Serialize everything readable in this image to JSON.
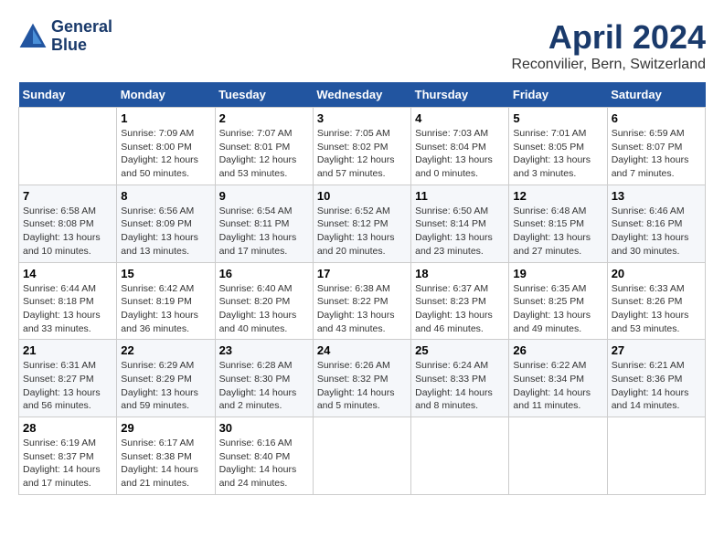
{
  "header": {
    "logo_line1": "General",
    "logo_line2": "Blue",
    "month_title": "April 2024",
    "subtitle": "Reconvilier, Bern, Switzerland"
  },
  "weekdays": [
    "Sunday",
    "Monday",
    "Tuesday",
    "Wednesday",
    "Thursday",
    "Friday",
    "Saturday"
  ],
  "weeks": [
    [
      {
        "day": "",
        "sunrise": "",
        "sunset": "",
        "daylight": ""
      },
      {
        "day": "1",
        "sunrise": "Sunrise: 7:09 AM",
        "sunset": "Sunset: 8:00 PM",
        "daylight": "Daylight: 12 hours and 50 minutes."
      },
      {
        "day": "2",
        "sunrise": "Sunrise: 7:07 AM",
        "sunset": "Sunset: 8:01 PM",
        "daylight": "Daylight: 12 hours and 53 minutes."
      },
      {
        "day": "3",
        "sunrise": "Sunrise: 7:05 AM",
        "sunset": "Sunset: 8:02 PM",
        "daylight": "Daylight: 12 hours and 57 minutes."
      },
      {
        "day": "4",
        "sunrise": "Sunrise: 7:03 AM",
        "sunset": "Sunset: 8:04 PM",
        "daylight": "Daylight: 13 hours and 0 minutes."
      },
      {
        "day": "5",
        "sunrise": "Sunrise: 7:01 AM",
        "sunset": "Sunset: 8:05 PM",
        "daylight": "Daylight: 13 hours and 3 minutes."
      },
      {
        "day": "6",
        "sunrise": "Sunrise: 6:59 AM",
        "sunset": "Sunset: 8:07 PM",
        "daylight": "Daylight: 13 hours and 7 minutes."
      }
    ],
    [
      {
        "day": "7",
        "sunrise": "Sunrise: 6:58 AM",
        "sunset": "Sunset: 8:08 PM",
        "daylight": "Daylight: 13 hours and 10 minutes."
      },
      {
        "day": "8",
        "sunrise": "Sunrise: 6:56 AM",
        "sunset": "Sunset: 8:09 PM",
        "daylight": "Daylight: 13 hours and 13 minutes."
      },
      {
        "day": "9",
        "sunrise": "Sunrise: 6:54 AM",
        "sunset": "Sunset: 8:11 PM",
        "daylight": "Daylight: 13 hours and 17 minutes."
      },
      {
        "day": "10",
        "sunrise": "Sunrise: 6:52 AM",
        "sunset": "Sunset: 8:12 PM",
        "daylight": "Daylight: 13 hours and 20 minutes."
      },
      {
        "day": "11",
        "sunrise": "Sunrise: 6:50 AM",
        "sunset": "Sunset: 8:14 PM",
        "daylight": "Daylight: 13 hours and 23 minutes."
      },
      {
        "day": "12",
        "sunrise": "Sunrise: 6:48 AM",
        "sunset": "Sunset: 8:15 PM",
        "daylight": "Daylight: 13 hours and 27 minutes."
      },
      {
        "day": "13",
        "sunrise": "Sunrise: 6:46 AM",
        "sunset": "Sunset: 8:16 PM",
        "daylight": "Daylight: 13 hours and 30 minutes."
      }
    ],
    [
      {
        "day": "14",
        "sunrise": "Sunrise: 6:44 AM",
        "sunset": "Sunset: 8:18 PM",
        "daylight": "Daylight: 13 hours and 33 minutes."
      },
      {
        "day": "15",
        "sunrise": "Sunrise: 6:42 AM",
        "sunset": "Sunset: 8:19 PM",
        "daylight": "Daylight: 13 hours and 36 minutes."
      },
      {
        "day": "16",
        "sunrise": "Sunrise: 6:40 AM",
        "sunset": "Sunset: 8:20 PM",
        "daylight": "Daylight: 13 hours and 40 minutes."
      },
      {
        "day": "17",
        "sunrise": "Sunrise: 6:38 AM",
        "sunset": "Sunset: 8:22 PM",
        "daylight": "Daylight: 13 hours and 43 minutes."
      },
      {
        "day": "18",
        "sunrise": "Sunrise: 6:37 AM",
        "sunset": "Sunset: 8:23 PM",
        "daylight": "Daylight: 13 hours and 46 minutes."
      },
      {
        "day": "19",
        "sunrise": "Sunrise: 6:35 AM",
        "sunset": "Sunset: 8:25 PM",
        "daylight": "Daylight: 13 hours and 49 minutes."
      },
      {
        "day": "20",
        "sunrise": "Sunrise: 6:33 AM",
        "sunset": "Sunset: 8:26 PM",
        "daylight": "Daylight: 13 hours and 53 minutes."
      }
    ],
    [
      {
        "day": "21",
        "sunrise": "Sunrise: 6:31 AM",
        "sunset": "Sunset: 8:27 PM",
        "daylight": "Daylight: 13 hours and 56 minutes."
      },
      {
        "day": "22",
        "sunrise": "Sunrise: 6:29 AM",
        "sunset": "Sunset: 8:29 PM",
        "daylight": "Daylight: 13 hours and 59 minutes."
      },
      {
        "day": "23",
        "sunrise": "Sunrise: 6:28 AM",
        "sunset": "Sunset: 8:30 PM",
        "daylight": "Daylight: 14 hours and 2 minutes."
      },
      {
        "day": "24",
        "sunrise": "Sunrise: 6:26 AM",
        "sunset": "Sunset: 8:32 PM",
        "daylight": "Daylight: 14 hours and 5 minutes."
      },
      {
        "day": "25",
        "sunrise": "Sunrise: 6:24 AM",
        "sunset": "Sunset: 8:33 PM",
        "daylight": "Daylight: 14 hours and 8 minutes."
      },
      {
        "day": "26",
        "sunrise": "Sunrise: 6:22 AM",
        "sunset": "Sunset: 8:34 PM",
        "daylight": "Daylight: 14 hours and 11 minutes."
      },
      {
        "day": "27",
        "sunrise": "Sunrise: 6:21 AM",
        "sunset": "Sunset: 8:36 PM",
        "daylight": "Daylight: 14 hours and 14 minutes."
      }
    ],
    [
      {
        "day": "28",
        "sunrise": "Sunrise: 6:19 AM",
        "sunset": "Sunset: 8:37 PM",
        "daylight": "Daylight: 14 hours and 17 minutes."
      },
      {
        "day": "29",
        "sunrise": "Sunrise: 6:17 AM",
        "sunset": "Sunset: 8:38 PM",
        "daylight": "Daylight: 14 hours and 21 minutes."
      },
      {
        "day": "30",
        "sunrise": "Sunrise: 6:16 AM",
        "sunset": "Sunset: 8:40 PM",
        "daylight": "Daylight: 14 hours and 24 minutes."
      },
      {
        "day": "",
        "sunrise": "",
        "sunset": "",
        "daylight": ""
      },
      {
        "day": "",
        "sunrise": "",
        "sunset": "",
        "daylight": ""
      },
      {
        "day": "",
        "sunrise": "",
        "sunset": "",
        "daylight": ""
      },
      {
        "day": "",
        "sunrise": "",
        "sunset": "",
        "daylight": ""
      }
    ]
  ]
}
